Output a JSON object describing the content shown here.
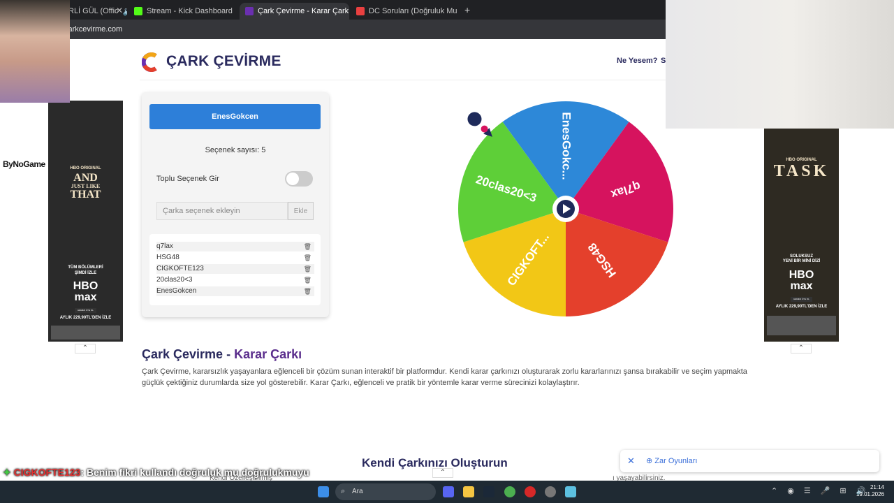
{
  "browser": {
    "tabs": [
      {
        "label": "RLİ GÜL (Offic",
        "active": false
      },
      {
        "label": "Stream - Kick Dashboard",
        "active": false
      },
      {
        "label": "Çark Çevirme - Karar Çarkı",
        "active": true
      },
      {
        "label": "DC Soruları (Doğruluk Mu Cesa",
        "active": false
      }
    ],
    "url": "carkcevirme.com"
  },
  "header": {
    "brand": "ÇARK ÇEVİRME",
    "nav": [
      "Ne Yesem?",
      "S"
    ]
  },
  "panel": {
    "title_button": "EnesGokcen",
    "count_text": "Seçenek sayısı: 5",
    "bulk_label": "Toplu Seçenek Gir",
    "bulk_toggle_on": false,
    "add_placeholder": "Çarka seçenek ekleyin",
    "add_button": "Ekle",
    "options": [
      "q7lax",
      "HSG48",
      "CIGKOFTE123",
      "20clas20<3",
      "EnesGokcen"
    ]
  },
  "wheel": {
    "slices": [
      {
        "label": "EnesGokc...",
        "color": "#2d88d8"
      },
      {
        "label": "q7lax",
        "color": "#d6135e"
      },
      {
        "label": "HSG48",
        "color": "#e4402c"
      },
      {
        "label": "CIGKOFT...",
        "color": "#f2c716"
      },
      {
        "label": "20clas20<3",
        "color": "#5ecf38"
      }
    ],
    "center_button": "play"
  },
  "content": {
    "heading_part1": "Çark Çevirme - ",
    "heading_part2": "Karar Çarkı",
    "paragraph": "Çark Çevirme, kararsızlık yaşayanlara eğlenceli bir çözüm sunan interaktif bir platformdur. Kendi karar çarkınızı oluşturarak zorlu kararlarınızı şansa bırakabilir ve seçim yapmakta güçlük çektiğiniz durumlarda size yol gösterebilir. Karar Çarkı, eğlenceli ve pratik bir yöntemle karar verme sürecinizi kolaylaştırır.",
    "heading2": "Kendi Çarkınızı Oluşturun",
    "subtext_left": "Kendi Özelleştirilmiş",
    "subtext_right": "ı yaşayabilirsiniz."
  },
  "ads": {
    "left": {
      "brand_top": "HBO ORIGINAL",
      "title_line1": "AND",
      "title_line2": "JUST LIKE",
      "title_line3": "THAT",
      "tag1": "TÜM BÖLÜMLERİ",
      "tag2": "ŞİMDİ İZLE",
      "logo1": "HBO",
      "logo2": "max",
      "cta": "HEMEN ÜYE OL",
      "price": "AYLIK 229,90TL'DEN İZLE"
    },
    "right": {
      "brand_top": "HBO ORIGINAL",
      "title": "TASK",
      "tag1": "SOLUKSUZ",
      "tag2": "YENİ BİR MİNİ DİZİ",
      "logo1": "HBO",
      "logo2": "max",
      "cta": "HEMEN ÜYE OL",
      "price": "AYLIK 229,90TL'DEN İZLE"
    }
  },
  "toast": {
    "label": "Zar Oyunları"
  },
  "overlay": {
    "sponsor": "ByNoGame",
    "chat_user": "CIGKOFTE123",
    "chat_message": ": Benim fikri kullandı doğruluk mu doğrulukmuyu"
  },
  "taskbar": {
    "search": "Ara",
    "time": "21:14",
    "date": "19.01.2026"
  }
}
